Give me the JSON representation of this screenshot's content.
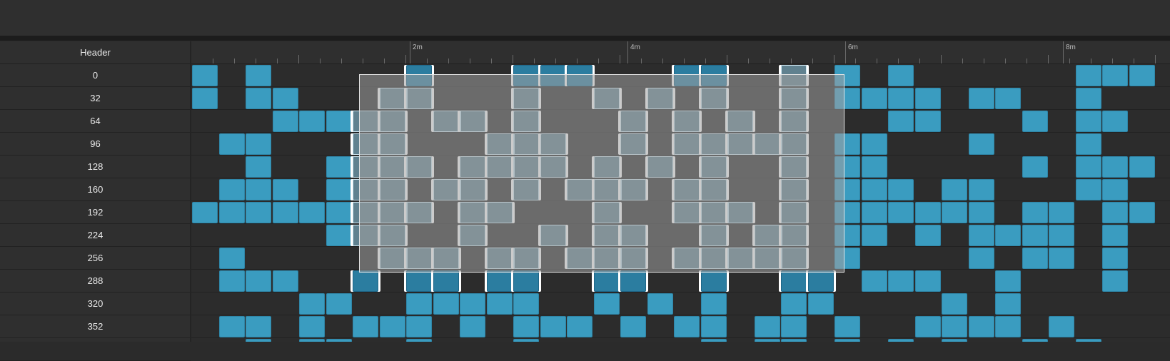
{
  "header": {
    "label": "Header"
  },
  "ruler": {
    "labels": [
      "2m",
      "4m",
      "6m",
      "8m"
    ]
  },
  "rows": [
    "0",
    "32",
    "64",
    "96",
    "128",
    "160",
    "192",
    "224",
    "256",
    "288",
    "320",
    "352",
    ""
  ],
  "colors": {
    "cell": "#3a9cc0",
    "selected_cell": "#2b7da0",
    "background": "#2b2b2b"
  },
  "cells": [
    [
      0,
      2,
      8,
      12,
      13,
      14,
      18,
      19,
      22,
      24,
      26,
      33,
      34,
      35
    ],
    [
      0,
      2,
      3,
      7,
      8,
      12,
      15,
      17,
      19,
      22,
      24,
      25,
      26,
      27,
      29,
      30,
      33
    ],
    [
      3,
      4,
      5,
      6,
      7,
      9,
      10,
      12,
      16,
      18,
      20,
      22,
      26,
      27,
      31,
      33,
      34
    ],
    [
      1,
      2,
      6,
      7,
      11,
      12,
      13,
      16,
      18,
      19,
      20,
      21,
      22,
      24,
      25,
      29,
      33
    ],
    [
      2,
      5,
      6,
      7,
      8,
      10,
      11,
      12,
      13,
      15,
      17,
      19,
      22,
      24,
      25,
      31,
      33,
      34,
      35
    ],
    [
      1,
      2,
      3,
      5,
      6,
      7,
      9,
      10,
      12,
      14,
      15,
      16,
      18,
      19,
      22,
      24,
      25,
      26,
      28,
      29,
      33,
      34
    ],
    [
      0,
      1,
      2,
      3,
      4,
      5,
      6,
      7,
      8,
      10,
      11,
      15,
      18,
      19,
      20,
      22,
      24,
      25,
      26,
      27,
      28,
      29,
      31,
      32,
      34,
      35
    ],
    [
      5,
      6,
      7,
      10,
      13,
      15,
      16,
      19,
      21,
      22,
      24,
      25,
      27,
      29,
      30,
      31,
      32,
      34
    ],
    [
      1,
      7,
      8,
      9,
      11,
      12,
      14,
      15,
      16,
      18,
      19,
      20,
      21,
      22,
      24,
      29,
      31,
      32,
      34
    ],
    [
      1,
      2,
      3,
      6,
      8,
      9,
      11,
      12,
      15,
      16,
      19,
      22,
      23,
      25,
      26,
      27,
      30,
      34
    ],
    [
      4,
      5,
      8,
      9,
      10,
      11,
      12,
      15,
      17,
      19,
      22,
      23,
      28,
      30
    ],
    [
      1,
      2,
      4,
      6,
      7,
      8,
      10,
      12,
      13,
      14,
      16,
      18,
      19,
      21,
      22,
      24,
      27,
      28,
      29,
      30,
      32
    ],
    [
      2,
      4,
      5,
      8,
      12,
      19,
      21,
      22,
      24,
      26,
      28,
      31,
      33
    ]
  ],
  "selected_cells": [
    [
      8,
      12,
      13,
      14,
      18,
      19,
      21
    ],
    [],
    [],
    [],
    [],
    [],
    [],
    [],
    [],
    [
      6,
      8,
      9,
      11,
      12,
      15,
      16,
      19,
      22,
      23
    ]
  ]
}
